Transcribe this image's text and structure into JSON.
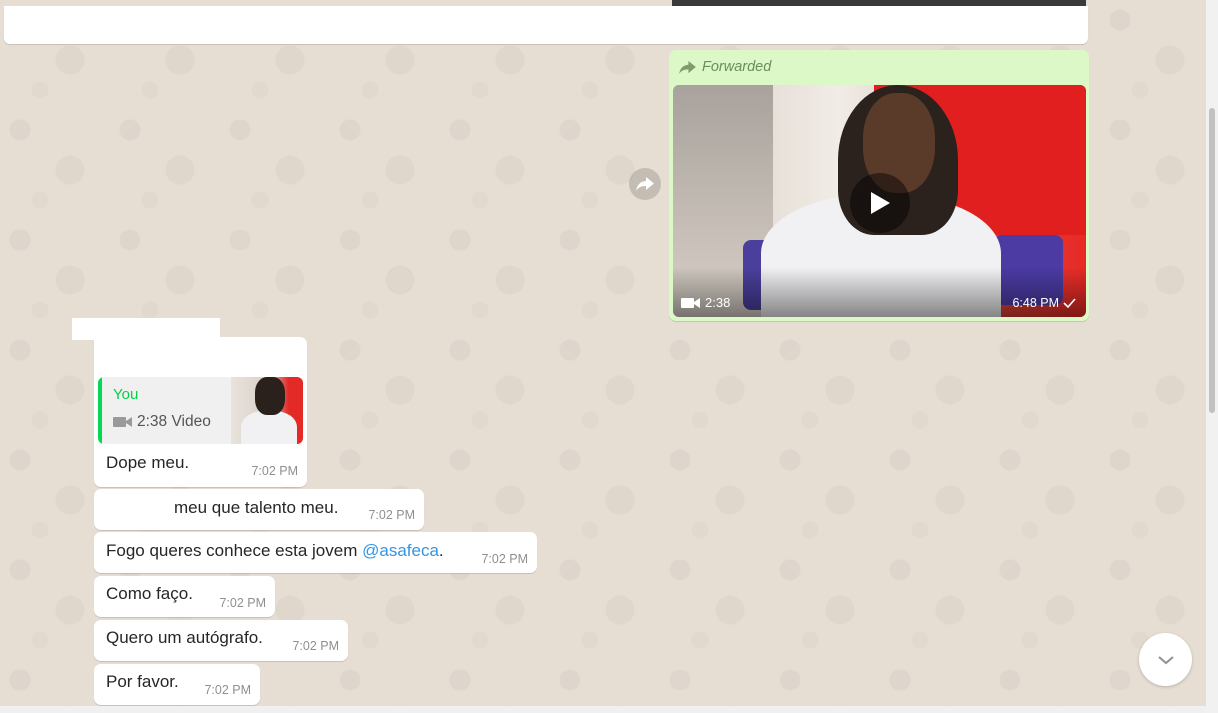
{
  "forwarded_message": {
    "label": "Forwarded",
    "video_duration": "2:38",
    "time": "6:48 PM"
  },
  "quoted_message": {
    "author": "You",
    "summary": "2:38 Video"
  },
  "messages": [
    {
      "text": "Dope meu.",
      "time": "7:02 PM"
    },
    {
      "text": "meu que talento meu.",
      "time": "7:02 PM"
    },
    {
      "text_before": "Fogo queres conhece esta jovem ",
      "mention": "@asafeca",
      "text_after": ".",
      "time": "7:02 PM"
    },
    {
      "text": "Como faço.",
      "time": "7:02 PM"
    },
    {
      "text": "Quero um autógrafo.",
      "time": "7:02 PM"
    },
    {
      "text": "Por favor.",
      "time": "7:02 PM"
    }
  ],
  "colors": {
    "outgoing_bubble": "#dcf8c6",
    "incoming_bubble": "#ffffff",
    "chat_background": "#e6ded3",
    "mention": "#3396e5",
    "quote_accent": "#06d755"
  }
}
